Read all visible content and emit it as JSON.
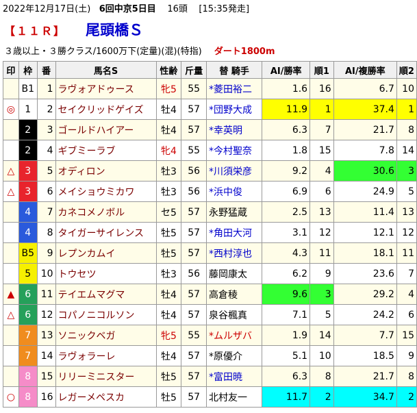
{
  "header": {
    "date": "2022年12月17日(土)",
    "meeting": "6回中京5日目",
    "runners": "16頭",
    "post_time": "[15:35発走]"
  },
  "race": {
    "number": "【１１Ｒ】",
    "name": "尾頭橋Ｓ",
    "conditions": "３歳以上・３勝クラス/1600万下(定量)(混)(特指)",
    "course": "ダート1800m"
  },
  "columns": [
    "印",
    "枠",
    "番",
    "馬名S",
    "性齢",
    "斤量",
    "替 騎手",
    "AI/勝率",
    "順1",
    "AI/複勝率",
    "順2"
  ],
  "colors": {
    "waku1": "#ffffff",
    "waku2": "#000000",
    "waku3": "#e8242c",
    "waku4": "#2a5adc",
    "waku5": "#f6f000",
    "waku6": "#25a05a",
    "waku7": "#f08c1e",
    "waku8": "#f58cc8",
    "highlight_first": "#ffff00",
    "highlight_third": "#33ff33",
    "highlight_second": "#00ffff"
  },
  "rows": [
    {
      "mark": "",
      "waku": "B1",
      "waku_class": "w1",
      "num": "1",
      "name": "ラヴォアドゥース",
      "sex": "牝5",
      "sex_red": true,
      "weight": "55",
      "jockey": "*菱田裕二",
      "jockey_type": "apprentice",
      "win": "1.6",
      "rank1": "16",
      "place": "6.7",
      "rank2": "10",
      "hl": ""
    },
    {
      "mark": "◎",
      "waku": "1",
      "waku_class": "w1",
      "num": "2",
      "name": "セイクリッドゲイズ",
      "sex": "牡4",
      "sex_red": false,
      "weight": "57",
      "jockey": "*団野大成",
      "jockey_type": "apprentice",
      "win": "11.9",
      "rank1": "1",
      "place": "37.4",
      "rank2": "1",
      "hl": "hl-yellow"
    },
    {
      "mark": "",
      "waku": "2",
      "waku_class": "w2",
      "num": "3",
      "name": "ゴールドハイアー",
      "sex": "牡4",
      "sex_red": false,
      "weight": "57",
      "jockey": "*幸英明",
      "jockey_type": "apprentice",
      "win": "6.3",
      "rank1": "7",
      "place": "21.7",
      "rank2": "8",
      "hl": ""
    },
    {
      "mark": "",
      "waku": "2",
      "waku_class": "w2",
      "num": "4",
      "name": "ギブミーラブ",
      "sex": "牝4",
      "sex_red": true,
      "weight": "55",
      "jockey": "*今村聖奈",
      "jockey_type": "apprentice",
      "win": "1.8",
      "rank1": "15",
      "place": "7.8",
      "rank2": "14",
      "hl": ""
    },
    {
      "mark": "△",
      "waku": "3",
      "waku_class": "w3",
      "num": "5",
      "name": "オディロン",
      "sex": "牡3",
      "sex_red": false,
      "weight": "56",
      "jockey": "*川須栄彦",
      "jockey_type": "apprentice",
      "win": "9.2",
      "rank1": "4",
      "place": "30.6",
      "rank2": "3",
      "hl": "hl-green-place"
    },
    {
      "mark": "△",
      "waku": "3",
      "waku_class": "w3",
      "num": "6",
      "name": "メイショウミカワ",
      "sex": "牡3",
      "sex_red": false,
      "weight": "56",
      "jockey": "*浜中俊",
      "jockey_type": "apprentice",
      "win": "6.9",
      "rank1": "6",
      "place": "24.9",
      "rank2": "5",
      "hl": ""
    },
    {
      "mark": "",
      "waku": "4",
      "waku_class": "w4",
      "num": "7",
      "name": "カネコメノボル",
      "sex": "セ5",
      "sex_red": false,
      "weight": "57",
      "jockey": "永野猛蔵",
      "jockey_type": "plain",
      "win": "2.5",
      "rank1": "13",
      "place": "11.4",
      "rank2": "13",
      "hl": ""
    },
    {
      "mark": "",
      "waku": "4",
      "waku_class": "w4",
      "num": "8",
      "name": "タイガーサイレンス",
      "sex": "牡5",
      "sex_red": false,
      "weight": "57",
      "jockey": "*角田大河",
      "jockey_type": "apprentice",
      "win": "3.1",
      "rank1": "12",
      "place": "12.1",
      "rank2": "12",
      "hl": ""
    },
    {
      "mark": "",
      "waku": "B5",
      "waku_class": "w5",
      "num": "9",
      "name": "レプンカムイ",
      "sex": "牡5",
      "sex_red": false,
      "weight": "57",
      "jockey": "*西村淳也",
      "jockey_type": "apprentice",
      "win": "4.3",
      "rank1": "11",
      "place": "18.1",
      "rank2": "11",
      "hl": ""
    },
    {
      "mark": "",
      "waku": "5",
      "waku_class": "w5",
      "num": "10",
      "name": "トウセツ",
      "sex": "牡3",
      "sex_red": false,
      "weight": "56",
      "jockey": "藤岡康太",
      "jockey_type": "plain",
      "win": "6.2",
      "rank1": "9",
      "place": "23.6",
      "rank2": "7",
      "hl": ""
    },
    {
      "mark": "▲",
      "waku": "6",
      "waku_class": "w6",
      "num": "11",
      "name": "テイエムマグマ",
      "sex": "牡4",
      "sex_red": false,
      "weight": "57",
      "jockey": "高倉稜",
      "jockey_type": "plain",
      "win": "9.6",
      "rank1": "3",
      "place": "29.2",
      "rank2": "4",
      "hl": "hl-green-win"
    },
    {
      "mark": "△",
      "waku": "6",
      "waku_class": "w6",
      "num": "12",
      "name": "コパノニコルソン",
      "sex": "牡4",
      "sex_red": false,
      "weight": "57",
      "jockey": "泉谷楓真",
      "jockey_type": "plain",
      "win": "7.1",
      "rank1": "5",
      "place": "24.2",
      "rank2": "6",
      "hl": ""
    },
    {
      "mark": "",
      "waku": "7",
      "waku_class": "w7",
      "num": "13",
      "name": "ソニックベガ",
      "sex": "牝5",
      "sex_red": true,
      "weight": "55",
      "jockey": "*ムルザバ",
      "jockey_type": "foreign",
      "win": "1.9",
      "rank1": "14",
      "place": "7.7",
      "rank2": "15",
      "hl": ""
    },
    {
      "mark": "",
      "waku": "7",
      "waku_class": "w7",
      "num": "14",
      "name": "ラヴォラーレ",
      "sex": "牡4",
      "sex_red": false,
      "weight": "57",
      "jockey": "*原優介",
      "jockey_type": "plain",
      "win": "5.1",
      "rank1": "10",
      "place": "18.5",
      "rank2": "9",
      "hl": ""
    },
    {
      "mark": "",
      "waku": "8",
      "waku_class": "w8",
      "num": "15",
      "name": "リリーミニスター",
      "sex": "牡5",
      "sex_red": false,
      "weight": "57",
      "jockey": "*富田暁",
      "jockey_type": "apprentice",
      "win": "6.3",
      "rank1": "8",
      "place": "21.7",
      "rank2": "8",
      "hl": ""
    },
    {
      "mark": "○",
      "waku": "8",
      "waku_class": "w8",
      "num": "16",
      "name": "レガーメペスカ",
      "sex": "牡5",
      "sex_red": false,
      "weight": "57",
      "jockey": "北村友一",
      "jockey_type": "plain",
      "win": "11.7",
      "rank1": "2",
      "place": "34.7",
      "rank2": "2",
      "hl": "hl-cyan"
    }
  ]
}
